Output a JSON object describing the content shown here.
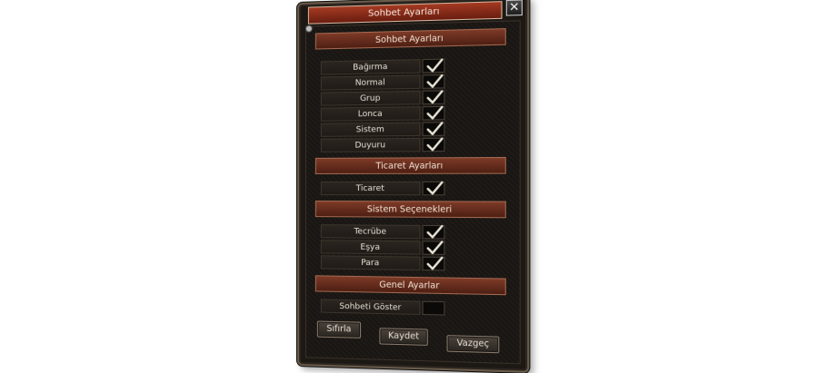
{
  "window": {
    "title": "Sohbet Ayarları",
    "close_label": "✕"
  },
  "sections": [
    {
      "header": "Sohbet Ayarları",
      "rows": [
        {
          "label": "Bağırma",
          "checked": true
        },
        {
          "label": "Normal",
          "checked": true
        },
        {
          "label": "Grup",
          "checked": true
        },
        {
          "label": "Lonca",
          "checked": true
        },
        {
          "label": "Sistem",
          "checked": true
        },
        {
          "label": "Duyuru",
          "checked": true
        }
      ]
    },
    {
      "header": "Ticaret Ayarları",
      "rows": [
        {
          "label": "Ticaret",
          "checked": true
        }
      ]
    },
    {
      "header": "Sistem Seçenekleri",
      "rows": [
        {
          "label": "Tecrübe",
          "checked": true
        },
        {
          "label": "Eşya",
          "checked": true
        },
        {
          "label": "Para",
          "checked": true
        }
      ]
    },
    {
      "header": "Genel Ayarlar",
      "rows": [
        {
          "label": "Sohbeti Göster",
          "checked": false
        }
      ]
    }
  ],
  "buttons": {
    "reset": "Sıfırla",
    "save": "Kaydet",
    "cancel": "Vazgeç"
  },
  "colors": {
    "title_red": "#8a2a17",
    "header_brown": "#6a2e1e",
    "check_color": "#e8e2d2"
  }
}
